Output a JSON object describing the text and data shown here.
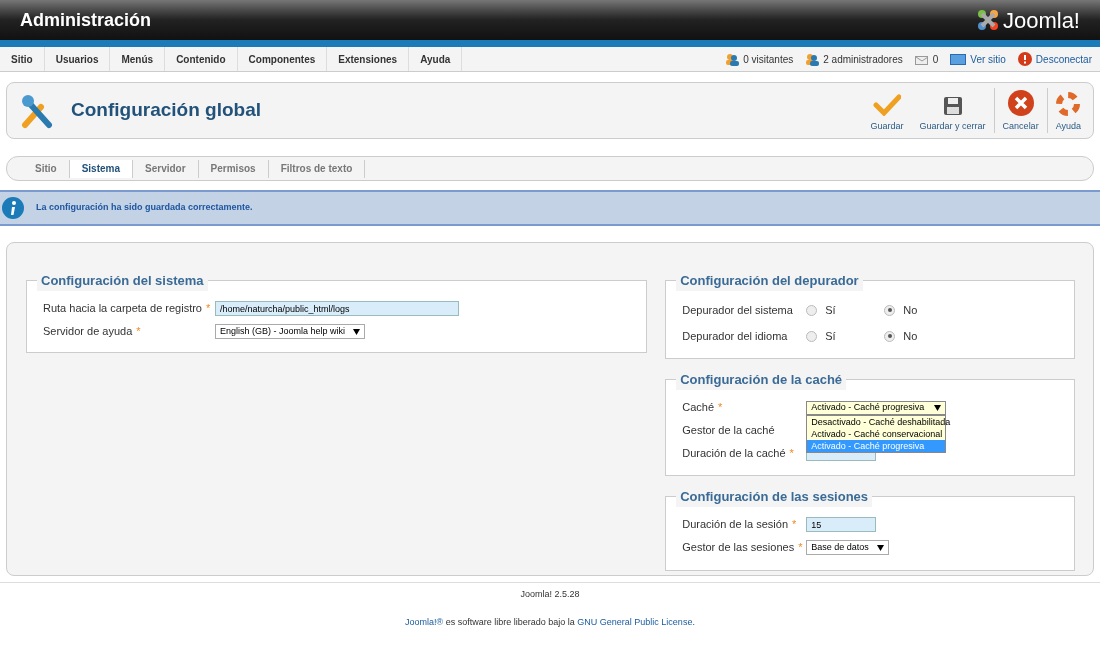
{
  "header": {
    "title": "Administración",
    "brand": "Joomla!"
  },
  "menu": [
    {
      "label": "Sitio"
    },
    {
      "label": "Usuarios"
    },
    {
      "label": "Menús"
    },
    {
      "label": "Contenido"
    },
    {
      "label": "Componentes"
    },
    {
      "label": "Extensiones"
    },
    {
      "label": "Ayuda"
    }
  ],
  "status": [
    {
      "kind": "visitors",
      "label": "0 visitantes"
    },
    {
      "kind": "admins",
      "label": "2 administradores"
    },
    {
      "kind": "messages",
      "label": "0"
    },
    {
      "kind": "site",
      "label": "Ver sitio"
    },
    {
      "kind": "logout",
      "label": "Desconectar"
    }
  ],
  "toolbar": {
    "title": "Configuración global",
    "buttons": [
      {
        "kind": "save",
        "label": "Guardar"
      },
      {
        "kind": "saveclose",
        "label": "Guardar y cerrar"
      },
      {
        "kind": "cancel",
        "label": "Cancelar"
      },
      {
        "kind": "help",
        "label": "Ayuda"
      }
    ]
  },
  "tabs": [
    {
      "label": "Sitio",
      "selected": false
    },
    {
      "label": "Sistema",
      "selected": true
    },
    {
      "label": "Servidor",
      "selected": false
    },
    {
      "label": "Permisos",
      "selected": false
    },
    {
      "label": "Filtros de texto",
      "selected": false
    }
  ],
  "message": "La configuración ha sido guardada correctamente.",
  "system": {
    "title": "Configuración del sistema",
    "fields": [
      {
        "kind": "text",
        "label": "Ruta hacia la carpeta de registro",
        "mark": "*",
        "value": "/home/naturcha/public_html/logs"
      },
      {
        "kind": "select",
        "label": "Servidor de ayuda",
        "mark": "*",
        "value": "English (GB) - Joomla help wiki"
      }
    ]
  },
  "debug": {
    "title": "Configuración del depurador",
    "fields": [
      {
        "label": "Depurador del sistema",
        "options": [
          {
            "label": "Sí",
            "selected": false
          },
          {
            "label": "No",
            "selected": true
          }
        ]
      },
      {
        "label": "Depurador del idioma",
        "options": [
          {
            "label": "Sí",
            "selected": false
          },
          {
            "label": "No",
            "selected": true
          }
        ]
      }
    ]
  },
  "cache": {
    "title": "Configuración de la caché",
    "fields": [
      {
        "kind": "dropdown",
        "label": "Caché",
        "mark": "*",
        "value": "Activado - Caché progresiva",
        "options": [
          {
            "label": "Desactivado - Caché deshabilitada",
            "selected": false
          },
          {
            "label": "Activado - Caché conservacional",
            "selected": false
          },
          {
            "label": "Activado - Caché progresiva",
            "selected": true
          }
        ]
      },
      {
        "kind": "hidden",
        "label": "Gestor de la caché"
      },
      {
        "kind": "short",
        "label": "Duración de la caché",
        "mark": "*"
      }
    ]
  },
  "session": {
    "title": "Configuración de las sesiones",
    "fields": [
      {
        "kind": "text",
        "label": "Duración de la sesión",
        "mark": "*",
        "value": "15"
      },
      {
        "kind": "select",
        "label": "Gestor de las sesiones",
        "mark": "*",
        "value": "Base de datos"
      }
    ]
  },
  "footer": {
    "version": "Joomla! 2.5.28",
    "license": [
      {
        "kind": "link",
        "text": "Joomla!®"
      },
      {
        "kind": "text",
        "text": " es software libre liberado bajo la "
      },
      {
        "kind": "link",
        "text": "GNU General Public License"
      },
      {
        "kind": "text",
        "text": "."
      }
    ]
  }
}
